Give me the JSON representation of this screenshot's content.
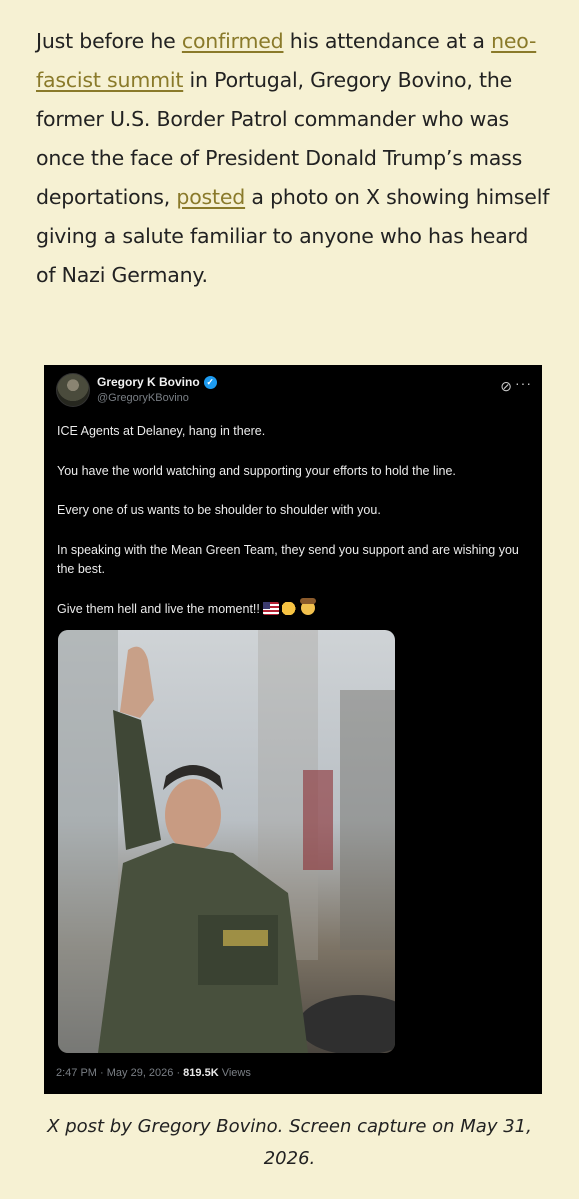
{
  "article": {
    "p1": "Just before he ",
    "link1": "confirmed",
    "p2": " his attendance at a ",
    "link2": "neo-fascist summit",
    "p3": " in Portugal, Gregory Bovino, the former U.S. Border Patrol commander who was once the face of President Donald Trump’s mass deportations, ",
    "link3": "posted",
    "p4": " a photo on X showing himself giving a salute familiar to anyone who has heard of Nazi Germany."
  },
  "post": {
    "name": "Gregory K Bovino",
    "handle": "@GregoryKBovino",
    "lines": [
      "ICE Agents at Delaney, hang in there.",
      "You have the world watching and supporting your efforts to hold the line.",
      "Every one of us wants to be shoulder to shoulder with you.",
      "In speaking with the Mean Green Team, they send you support and are wishing you the best.",
      "Give them hell and live the moment!!"
    ],
    "time": "2:47 PM · May 29, 2026 · ",
    "views_count": "819.5K",
    "views_label": " Views"
  },
  "caption": "X post by Gregory Bovino. Screen capture on May 31, 2026.",
  "icons": {
    "verified": "verified-badge-icon",
    "grok": "grok-icon",
    "more": "more-options-icon",
    "emojis": [
      "us-flag-icon",
      "flexed-biceps-icon",
      "cowboy-face-icon"
    ]
  }
}
